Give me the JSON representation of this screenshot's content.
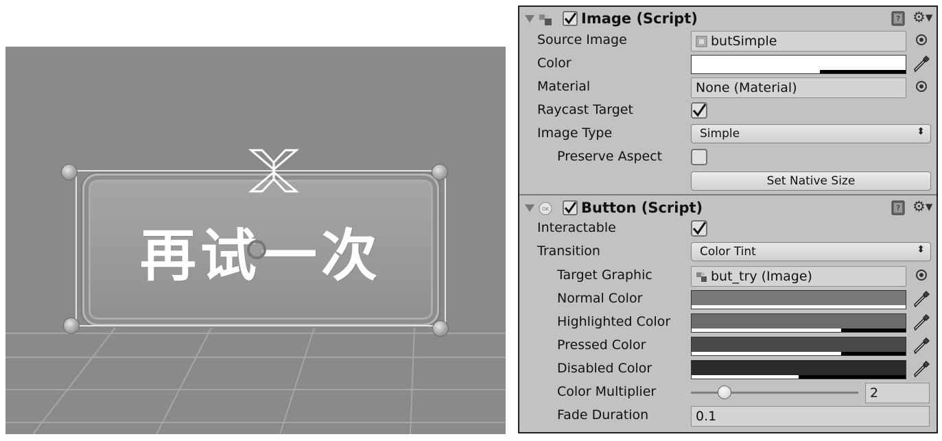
{
  "scene": {
    "button_label": "再试一次"
  },
  "image_component": {
    "title": "Image (Script)",
    "enabled": true,
    "icon": "image-component-icon",
    "fields": {
      "source_image": {
        "label": "Source Image",
        "value": "butSimple"
      },
      "color": {
        "label": "Color",
        "value": "#ffffff",
        "alpha": 0.6
      },
      "material": {
        "label": "Material",
        "value": "None (Material)"
      },
      "raycast_target": {
        "label": "Raycast Target",
        "checked": true
      },
      "image_type": {
        "label": "Image Type",
        "value": "Simple"
      },
      "preserve_aspect": {
        "label": "Preserve Aspect",
        "checked": false
      },
      "set_native_size": {
        "label": "Set Native Size"
      }
    }
  },
  "button_component": {
    "title": "Button (Script)",
    "enabled": true,
    "icon": "button-component-icon",
    "icon_text": "OK",
    "fields": {
      "interactable": {
        "label": "Interactable",
        "checked": true
      },
      "transition": {
        "label": "Transition",
        "value": "Color Tint"
      },
      "target_graphic": {
        "label": "Target Graphic",
        "value": "but_try (Image)"
      },
      "normal_color": {
        "label": "Normal Color",
        "value": "#7a7a7a",
        "alpha": 1.0
      },
      "highlighted_color": {
        "label": "Highlighted Color",
        "value": "#6c6c6c",
        "alpha": 0.7
      },
      "pressed_color": {
        "label": "Pressed Color",
        "value": "#4a4a4a",
        "alpha": 0.7
      },
      "disabled_color": {
        "label": "Disabled Color",
        "value": "#2a2a2a",
        "alpha": 0.5
      },
      "color_multiplier": {
        "label": "Color Multiplier",
        "value": "2",
        "slider_fraction": 0.2
      },
      "fade_duration": {
        "label": "Fade Duration",
        "value": "0.1"
      }
    }
  }
}
